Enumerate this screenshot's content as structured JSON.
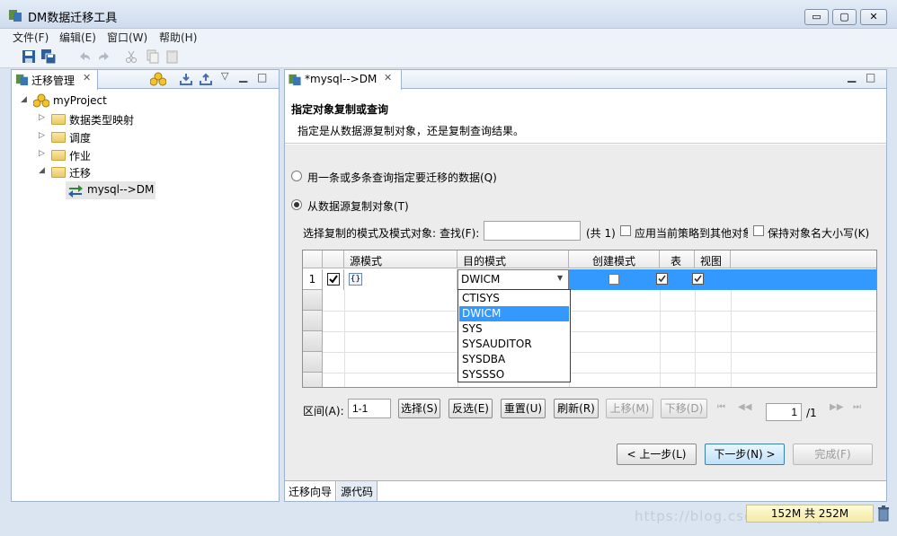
{
  "window": {
    "title": "DM数据迁移工具",
    "min_label": "▭",
    "max_label": "▢",
    "close_label": "✕"
  },
  "menu": [
    "文件(F)",
    "编辑(E)",
    "窗口(W)",
    "帮助(H)"
  ],
  "left_panel": {
    "tab_label": "迁移管理",
    "tree": {
      "project": "myProject",
      "nodes": [
        "数据类型映射",
        "调度",
        "作业",
        "迁移"
      ],
      "leaf": "mysql-->DM"
    }
  },
  "editor": {
    "tab_label": "*mysql-->DM",
    "heading": "指定对象复制或查询",
    "subheading": "指定是从数据源复制对象，还是复制查询结果。",
    "option_query": "用一条或多条查询指定要迁移的数据(Q)",
    "option_copy": "从数据源复制对象(T)",
    "option_selected": "copy",
    "filter": {
      "label": "选择复制的模式及模式对象:",
      "find_label": "查找(F):",
      "find_value": "",
      "count": "(共 1)",
      "apply_policy": "应用当前策略到其他对象",
      "apply_policy_checked": false,
      "keep_case": "保持对象名大小写(K)",
      "keep_case_checked": false
    },
    "grid": {
      "columns": [
        "源模式",
        "目的模式",
        "创建模式",
        "表",
        "视图"
      ],
      "rows": [
        {
          "num": "1",
          "checked": true,
          "source": "{}",
          "target": "DWICM",
          "create": false,
          "table": true,
          "view": true
        }
      ],
      "dropdown": {
        "options": [
          "CTISYS",
          "DWICM",
          "SYS",
          "SYSAUDITOR",
          "SYSDBA",
          "SYSSSO"
        ],
        "selected": "DWICM"
      }
    },
    "range": {
      "label": "区间(A):",
      "value": "1-1",
      "select_btn": "选择(S)",
      "invert_btn": "反选(E)",
      "reset_btn": "重置(U)",
      "refresh_btn": "刷新(R)",
      "up_btn": "上移(M)",
      "down_btn": "下移(D)",
      "page_value": "1",
      "page_total": "/1"
    },
    "nav": {
      "back": "< 上一步(L)",
      "next": "下一步(N) >",
      "finish": "完成(F)"
    },
    "bottom_tabs": [
      "迁移向导",
      "源代码"
    ]
  },
  "status": {
    "memory": "152M 共 252M",
    "watermark": "https://blog.csdn.net/boywe"
  },
  "colors": {
    "selection": "#3399ff",
    "chrome": "#dbe5f1"
  }
}
